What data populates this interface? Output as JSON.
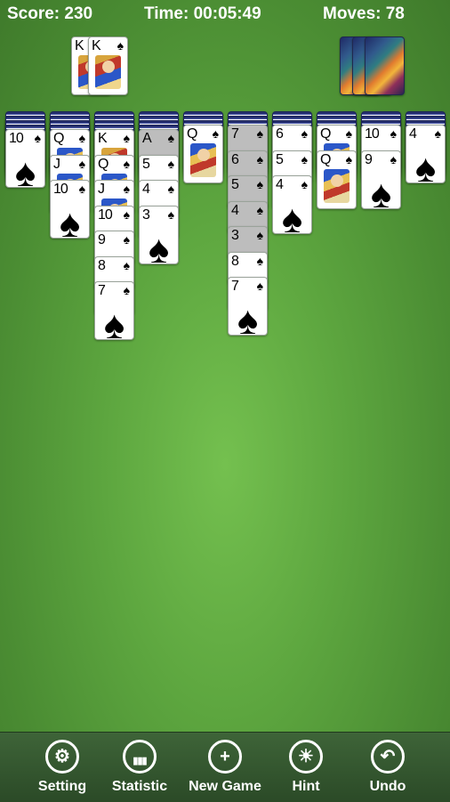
{
  "header": {
    "score": "Score: 230",
    "time": "Time: 00:05:49",
    "moves": "Moves: 78"
  },
  "foundation": [
    {
      "rank": "K",
      "suit": "♠"
    },
    {
      "rank": "K",
      "suit": "♠"
    }
  ],
  "stock_piles_remaining": 3,
  "tableau": [
    {
      "hidden": 4,
      "cards": [
        {
          "rank": "10",
          "suit": "♠"
        }
      ]
    },
    {
      "hidden": 4,
      "cards": [
        {
          "rank": "Q",
          "suit": "♠"
        },
        {
          "rank": "J",
          "suit": "♠"
        },
        {
          "rank": "10",
          "suit": "♠"
        }
      ]
    },
    {
      "hidden": 4,
      "cards": [
        {
          "rank": "K",
          "suit": "♠"
        },
        {
          "rank": "Q",
          "suit": "♠"
        },
        {
          "rank": "J",
          "suit": "♠"
        },
        {
          "rank": "10",
          "suit": "♠"
        },
        {
          "rank": "9",
          "suit": "♠"
        },
        {
          "rank": "8",
          "suit": "♠"
        },
        {
          "rank": "7",
          "suit": "♠"
        }
      ]
    },
    {
      "hidden": 4,
      "cards": [
        {
          "rank": "A",
          "suit": "♠",
          "dim": true
        },
        {
          "rank": "5",
          "suit": "♠"
        },
        {
          "rank": "4",
          "suit": "♠"
        },
        {
          "rank": "3",
          "suit": "♠"
        }
      ]
    },
    {
      "hidden": 3,
      "cards": [
        {
          "rank": "Q",
          "suit": "♠"
        }
      ]
    },
    {
      "hidden": 3,
      "cards": [
        {
          "rank": "7",
          "suit": "♠",
          "dim": true
        },
        {
          "rank": "6",
          "suit": "♠",
          "dim": true
        },
        {
          "rank": "5",
          "suit": "♠",
          "dim": true
        },
        {
          "rank": "4",
          "suit": "♠",
          "dim": true
        },
        {
          "rank": "3",
          "suit": "♠",
          "dim": true
        },
        {
          "rank": "8",
          "suit": "♠"
        },
        {
          "rank": "7",
          "suit": "♠"
        }
      ]
    },
    {
      "hidden": 3,
      "cards": [
        {
          "rank": "6",
          "suit": "♠"
        },
        {
          "rank": "5",
          "suit": "♠"
        },
        {
          "rank": "4",
          "suit": "♠"
        }
      ]
    },
    {
      "hidden": 3,
      "cards": [
        {
          "rank": "Q",
          "suit": "♠"
        },
        {
          "rank": "Q",
          "suit": "♠"
        }
      ]
    },
    {
      "hidden": 3,
      "cards": [
        {
          "rank": "10",
          "suit": "♠"
        },
        {
          "rank": "9",
          "suit": "♠"
        }
      ]
    },
    {
      "hidden": 3,
      "cards": [
        {
          "rank": "4",
          "suit": "♠"
        }
      ]
    }
  ],
  "toolbar": [
    {
      "label": "Setting",
      "icon": "gear-icon",
      "glyph": "⚙"
    },
    {
      "label": "Statistic",
      "icon": "bar-chart-icon",
      "glyph": "▮▮▮"
    },
    {
      "label": "New Game",
      "icon": "plus-icon",
      "glyph": "+"
    },
    {
      "label": "Hint",
      "icon": "lightbulb-icon",
      "glyph": "☀"
    },
    {
      "label": "Undo",
      "icon": "undo-arrow-icon",
      "glyph": "↶"
    }
  ],
  "colors": {
    "felt": "#5da63f",
    "toolbar": "#2b4a27",
    "card_back": "#26306e"
  }
}
